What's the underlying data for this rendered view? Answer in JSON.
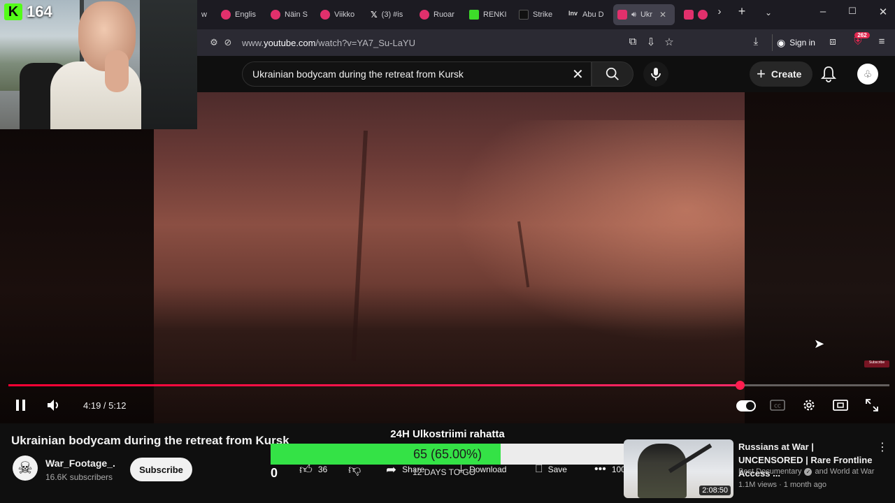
{
  "browser": {
    "tabs": [
      {
        "label": "w a",
        "favicon": "none",
        "active": false
      },
      {
        "label": "Englis",
        "favicon": "red-circle",
        "active": false
      },
      {
        "label": "Näin S",
        "favicon": "red-circle",
        "active": false
      },
      {
        "label": "Viikko",
        "favicon": "red-circle",
        "active": false
      },
      {
        "label": "(3) #is",
        "favicon": "x-logo",
        "active": false
      },
      {
        "label": "Ruoar",
        "favicon": "red-circle",
        "active": false
      },
      {
        "label": "RENKI",
        "favicon": "kick-logo",
        "active": false
      },
      {
        "label": "Strike",
        "favicon": "dark-square",
        "active": false
      },
      {
        "label": "Abu D",
        "favicon": "inv-logo",
        "active": false
      },
      {
        "label": "Ukr",
        "favicon": "youtube",
        "active": true
      },
      {
        "label": "",
        "favicon": "youtube",
        "active": false
      }
    ],
    "url_prefix": "www.",
    "url_host": "youtube.com",
    "url_path": "/watch?v=YA7_Su-LaYU",
    "sign_in": "Sign in",
    "extension_badge": "262"
  },
  "youtube": {
    "search_value": "Ukrainian bodycam during the retreat from Kursk",
    "create_label": "Create"
  },
  "player": {
    "current_time": "4:19",
    "duration": "5:12",
    "progress": 0.83,
    "mini_subscribe": "Subscribe"
  },
  "video": {
    "title": "Ukrainian bodycam during the retreat from Kursk",
    "channel": "War_Footage_.",
    "subscribers": "16.6K subscribers",
    "subscribe_label": "Subscribe",
    "likes": "36",
    "share_label": "Share",
    "download_label": "Download",
    "save_label": "Save",
    "more_label": "100"
  },
  "overlay": {
    "title": "24H Ulkostriimi rahatta",
    "goal_text": "65 (65.00%)",
    "goal_fraction": 0.65,
    "count": "0",
    "days_left": "12 DAYS TO GO"
  },
  "recommendation": {
    "title": "Russians at War | UNCENSORED | Rare Frontline Access ...",
    "channel": "Best Documentary",
    "channel_suffix": "and World at War",
    "meta": "1.1M views · 1 month ago",
    "duration": "2:08:50"
  },
  "stream": {
    "viewer_count": "164",
    "platform_logo": "K"
  },
  "colors": {
    "progress_red": "#ff0033",
    "goal_green": "#34e246",
    "kick_green": "#53fc18"
  }
}
